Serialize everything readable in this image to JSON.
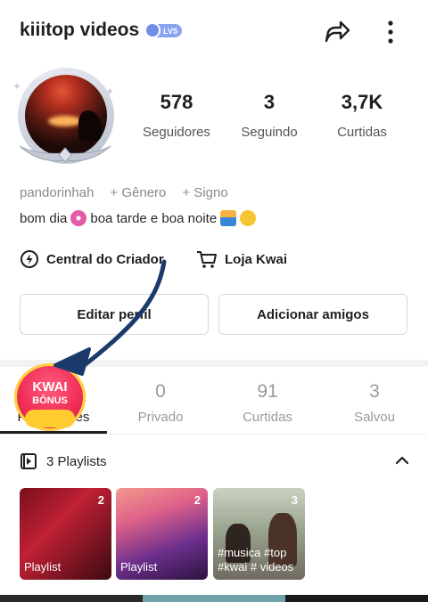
{
  "profile": {
    "name": "kiiitop videos",
    "level_badge": "LV5",
    "handle": "pandorinhah",
    "gender_link": "+ Gênero",
    "sign_link": "+ Signo",
    "bio": "bom dia 🌸 boa tarde e boa noite 🌅😃",
    "bio_text_1": "bom dia",
    "bio_text_2": "boa tarde e boa noite"
  },
  "stats": [
    {
      "value": "578",
      "label": "Seguidores"
    },
    {
      "value": "3",
      "label": "Seguindo"
    },
    {
      "value": "3,7K",
      "label": "Curtidas"
    }
  ],
  "links": {
    "creator_center": "Central do Criador",
    "kwai_shop": "Loja Kwai"
  },
  "buttons": {
    "edit_profile": "Editar perfil",
    "add_friends": "Adicionar amigos"
  },
  "tabs": [
    {
      "value": "",
      "label": "Publicações"
    },
    {
      "value": "0",
      "label": "Privado"
    },
    {
      "value": "91",
      "label": "Curtidas"
    },
    {
      "value": "3",
      "label": "Salvou"
    }
  ],
  "bonus": {
    "line1": "KWAI",
    "line2": "BÔNUS"
  },
  "playlists": {
    "header": "3 Playlists",
    "items": [
      {
        "count": "2",
        "caption": "Playlist"
      },
      {
        "count": "2",
        "caption": "Playlist"
      },
      {
        "count": "3",
        "caption": "#musica #top #kwai # videos"
      }
    ]
  },
  "colors": {
    "accent_bonus": "#ef2d56",
    "level_badge": "#8aa3f0",
    "annotation_arrow": "#1b3a6b"
  }
}
